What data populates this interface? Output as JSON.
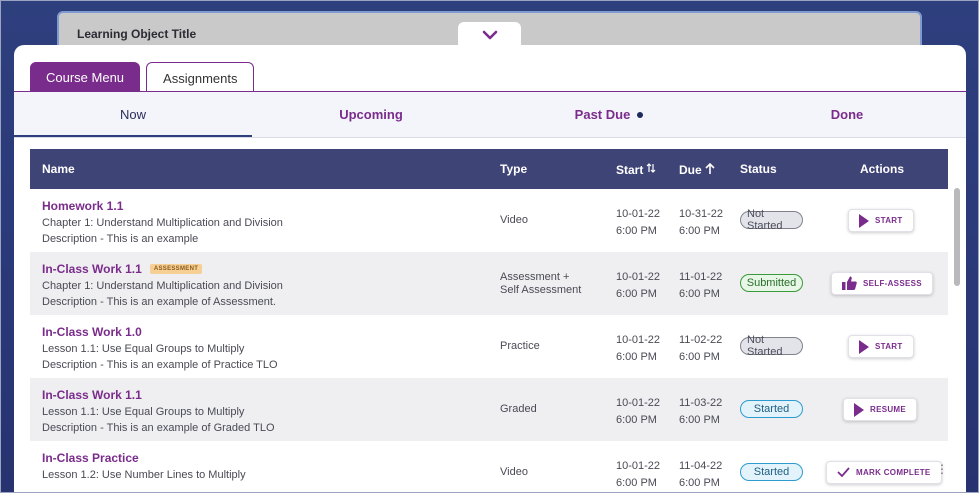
{
  "learning_object": {
    "title": "Learning Object Title",
    "collapse_icon": "chevron-down-icon"
  },
  "top_tabs": [
    {
      "label": "Course Menu",
      "active": true
    },
    {
      "label": "Assignments",
      "active": false
    }
  ],
  "sub_tabs": [
    {
      "label": "Now",
      "active": true
    },
    {
      "label": "Upcoming",
      "active": false
    },
    {
      "label": "Past Due",
      "active": false,
      "indicator": "dot"
    },
    {
      "label": "Done",
      "active": false
    }
  ],
  "table": {
    "headers": {
      "name": "Name",
      "type": "Type",
      "start": "Start",
      "start_icon": "sort-both-icon",
      "due": "Due",
      "due_icon": "sort-up-icon",
      "status": "Status",
      "actions": "Actions"
    },
    "rows": [
      {
        "title": "Homework 1.1",
        "badge": "",
        "line1": "Chapter 1: Understand Multiplication and Division",
        "line2": "Description - This is an example",
        "type": "Video",
        "type2": "",
        "start_date": "10-01-22",
        "start_time": "6:00 PM",
        "due_date": "10-31-22",
        "due_time": "6:00 PM",
        "status": "Not Started",
        "status_kind": "not-started",
        "action": "START",
        "action_icon": "play-icon"
      },
      {
        "title": "In-Class Work 1.1",
        "badge": "ASSESSMENT",
        "line1": "Chapter 1: Understand Multiplication and Division",
        "line2": "Description - This is an example of Assessment.",
        "type": "Assessment +",
        "type2": "Self Assessment",
        "start_date": "10-01-22",
        "start_time": "6:00 PM",
        "due_date": "11-01-22",
        "due_time": "6:00 PM",
        "status": "Submitted",
        "status_kind": "submitted",
        "action": "SELF-ASSESS",
        "action_icon": "thumbs-up-icon"
      },
      {
        "title": "In-Class Work 1.0",
        "badge": "",
        "line1": "Lesson 1.1: Use Equal Groups to Multiply",
        "line2": "Description - This is an example of Practice TLO",
        "type": "Practice",
        "type2": "",
        "start_date": "10-01-22",
        "start_time": "6:00 PM",
        "due_date": "11-02-22",
        "due_time": "6:00 PM",
        "status": "Not Started",
        "status_kind": "not-started",
        "action": "START",
        "action_icon": "play-icon"
      },
      {
        "title": "In-Class Work 1.1",
        "badge": "",
        "line1": "Lesson 1.1: Use Equal Groups to Multiply",
        "line2": "Description - This is an example of Graded TLO",
        "type": "Graded",
        "type2": "",
        "start_date": "10-01-22",
        "start_time": "6:00 PM",
        "due_date": "11-03-22",
        "due_time": "6:00 PM",
        "status": "Started",
        "status_kind": "started",
        "action": "RESUME",
        "action_icon": "play-icon"
      },
      {
        "title": "In-Class Practice",
        "badge": "",
        "line1": "Lesson 1.2: Use Number Lines to Multiply",
        "line2": "",
        "type": "Video",
        "type2": "",
        "start_date": "10-01-22",
        "start_time": "6:00 PM",
        "due_date": "11-04-22",
        "due_time": "6:00 PM",
        "status": "Started",
        "status_kind": "started",
        "action": "MARK COMPLETE",
        "action_icon": "checkmark-icon"
      }
    ]
  },
  "colors": {
    "brand_purple": "#7a2c8c",
    "header_navy": "#3f4476",
    "background_navy": "#2e3f7e"
  }
}
